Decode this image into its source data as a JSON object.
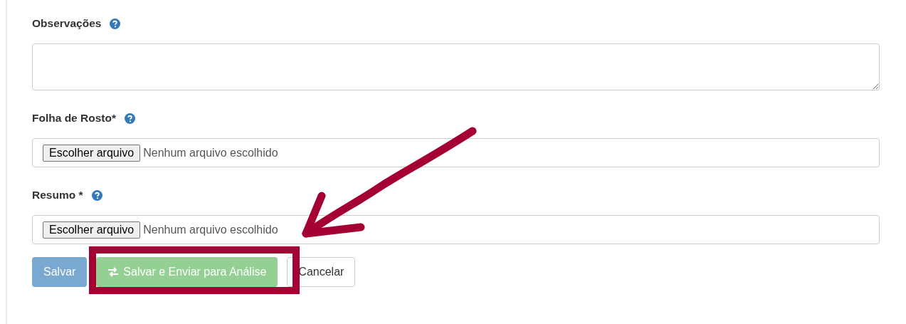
{
  "fields": [
    {
      "kind": "textarea",
      "label": "Observações",
      "help": true
    },
    {
      "kind": "file",
      "label": "Folha de Rosto*",
      "help": true,
      "button": "Escolher arquivo",
      "status": "Nenhum arquivo escolhido"
    },
    {
      "kind": "file",
      "label": "Resumo *",
      "help": true,
      "button": "Escolher arquivo",
      "status": "Nenhum arquivo escolhido"
    }
  ],
  "buttons": [
    {
      "kind": "primary",
      "label": "Salvar",
      "disabled": true,
      "icon": false
    },
    {
      "kind": "success",
      "label": "Salvar e Enviar para Análise",
      "disabled": true,
      "icon": true
    },
    {
      "kind": "default",
      "label": "Cancelar",
      "disabled": false,
      "icon": false
    }
  ]
}
